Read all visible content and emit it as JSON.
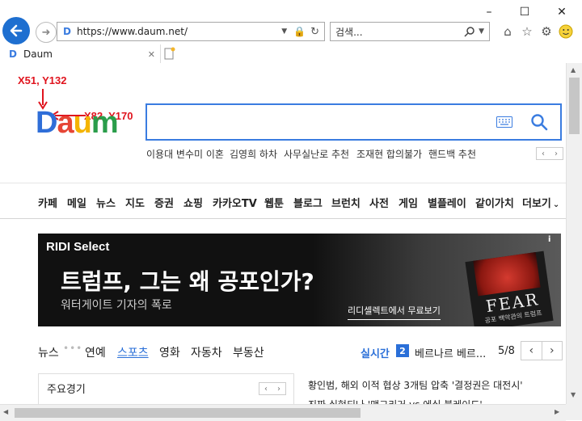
{
  "window": {
    "minimize": "–",
    "maximize": "☐",
    "close": "✕"
  },
  "address": {
    "url": "https://www.daum.net/"
  },
  "browser_search": {
    "placeholder": "검색..."
  },
  "tab": {
    "title": "Daum"
  },
  "annotations": [
    {
      "label": "X51, Y132"
    },
    {
      "label": "X82, Y170"
    }
  ],
  "logo": {
    "text": "Daum"
  },
  "trending": [
    "이용대 변수미 이혼",
    "김영희 하차",
    "사무실난로 추천",
    "조재현 합의불가",
    "핸드백 추천"
  ],
  "nav": [
    "카페",
    "메일",
    "뉴스",
    "지도",
    "증권",
    "쇼핑",
    "카카오TV",
    "웹툰",
    "블로그",
    "브런치",
    "사전",
    "게임",
    "별플레이",
    "같이가치",
    "더보기"
  ],
  "banner": {
    "brand": "RIDI Select",
    "headline": "트럼프, 그는 왜 공포인가?",
    "sub": "워터게이트 기자의 폭로",
    "cta": "리디셀렉트에서 무료보기",
    "book_title": "FEAR",
    "book_sub": "공포 백악관의 트럼프",
    "info": "i"
  },
  "news_tabs": [
    "뉴스",
    "연예",
    "스포츠",
    "영화",
    "자동차",
    "부동산"
  ],
  "news_tabs_active": "스포츠",
  "realtime": {
    "label": "실시간",
    "rank": "2",
    "text": "베르나르 베르...",
    "page": "5/8"
  },
  "lower_box": {
    "title": "주요경기"
  },
  "headlines": [
    "황인범, 해외 이적 협상 3개팀 압축 '결정권은 대전시'",
    "진짜 실현되나 '맥그리거 vs 에실 블레이드'"
  ],
  "colors": {
    "accent": "#3a7ce0",
    "annotation": "#e0141e",
    "daum_blue": "#1e6fd0"
  }
}
